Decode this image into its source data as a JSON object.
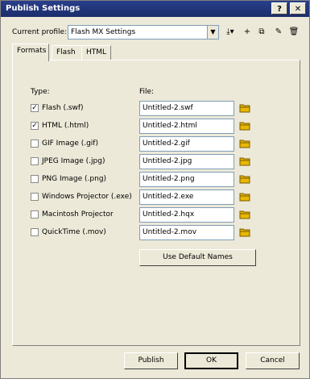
{
  "window": {
    "title": "Publish Settings",
    "help_glyph": "?",
    "close_glyph": "✕"
  },
  "profile": {
    "label": "Current profile:",
    "value": "Flash MX Settings",
    "dropdown_glyph": "▼",
    "toolbar": [
      {
        "name": "import-export-icon",
        "glyph": "⤓▾"
      },
      {
        "name": "add-profile-icon",
        "glyph": "+"
      },
      {
        "name": "duplicate-profile-icon",
        "glyph": "⧉"
      },
      {
        "name": "profile-properties-icon",
        "glyph": "✎"
      },
      {
        "name": "delete-profile-icon",
        "glyph": "🗑"
      }
    ]
  },
  "tabs": [
    "Formats",
    "Flash",
    "HTML"
  ],
  "formats": {
    "type_header": "Type:",
    "file_header": "File:",
    "rows": [
      {
        "label": "Flash (.swf)",
        "file": "Untitled-2.swf",
        "checked": true,
        "enabled": true
      },
      {
        "label": "HTML (.html)",
        "file": "Untitled-2.html",
        "checked": true,
        "enabled": true
      },
      {
        "label": "GIF Image (.gif)",
        "file": "Untitled-2.gif",
        "checked": false,
        "enabled": true
      },
      {
        "label": "JPEG Image (.jpg)",
        "file": "Untitled-2.jpg",
        "checked": false,
        "enabled": true
      },
      {
        "label": "PNG Image (.png)",
        "file": "Untitled-2.png",
        "checked": false,
        "enabled": true
      },
      {
        "label": "Windows Projector (.exe)",
        "file": "Untitled-2.exe",
        "checked": false,
        "enabled": true
      },
      {
        "label": "Macintosh Projector",
        "file": "Untitled-2.hqx",
        "checked": false,
        "enabled": true
      },
      {
        "label": "QuickTime (.mov)",
        "file": "Untitled-2.mov",
        "checked": false,
        "enabled": true
      }
    ],
    "default_names_button": "Use Default Names"
  },
  "footer": {
    "publish": "Publish",
    "ok": "OK",
    "cancel": "Cancel"
  },
  "colors": {
    "titlebar": "#1b2d6b",
    "face": "#ece9d8",
    "folder": "#e8b800"
  }
}
